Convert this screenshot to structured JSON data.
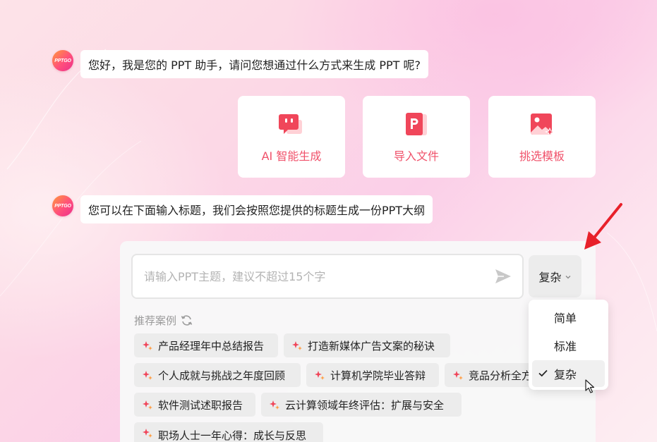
{
  "avatar": {
    "logo_text": "PPTGO"
  },
  "messages": {
    "greeting": "您好，我是您的 PPT 助手，请问您想通过什么方式来生成 PPT 呢?",
    "instruction": "您可以在下面输入标题，我们会按照您提供的标题生成一份PPT大纲"
  },
  "options": [
    {
      "label": "AI 智能生成",
      "icon": "chat-bubble-icon"
    },
    {
      "label": "导入文件",
      "icon": "ppt-file-icon"
    },
    {
      "label": "挑选模板",
      "icon": "template-image-icon"
    }
  ],
  "input": {
    "placeholder": "请输入PPT主题，建议不超过15个字",
    "value": ""
  },
  "mode": {
    "current": "复杂",
    "options": [
      "简单",
      "标准",
      "复杂"
    ],
    "selected_index": 2
  },
  "recommend": {
    "title": "推荐案例",
    "chips": [
      "产品经理年中总结报告",
      "打造新媒体广告文案的秘诀",
      "个人成就与挑战之年度回顾",
      "计算机学院毕业答辩",
      "竞品分析全方位",
      "软件测试述职报告",
      "云计算领域年终评估：扩展与安全",
      "职场人士一年心得：成长与反思"
    ]
  },
  "colors": {
    "accent": "#f0516a",
    "arrow": "#e8202a",
    "icon_red": "#f0465a"
  }
}
